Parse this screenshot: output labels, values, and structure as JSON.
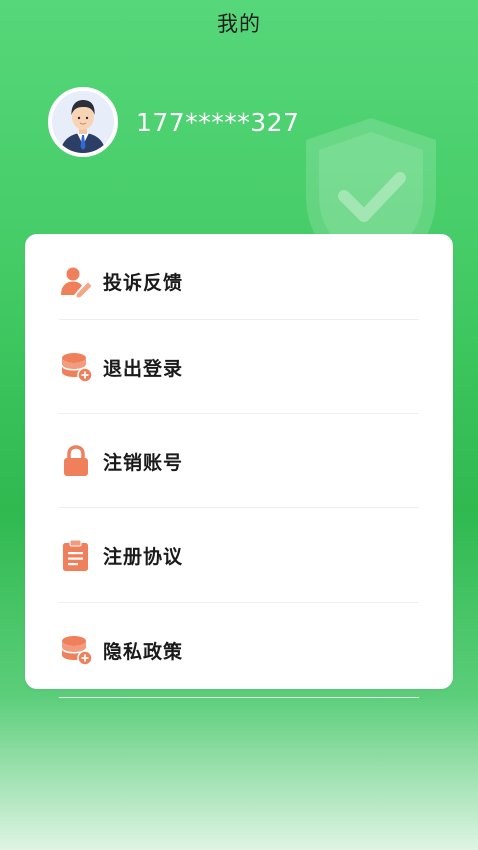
{
  "header": {
    "title": "我的"
  },
  "profile": {
    "phone": "177*****327",
    "avatar_icon": "businessman-avatar"
  },
  "theme": {
    "accent_green": "#45cc67",
    "icon_orange": "#f07f5b"
  },
  "menu": {
    "items": [
      {
        "label": "投诉反馈",
        "icon": "user-edit-icon"
      },
      {
        "label": "退出登录",
        "icon": "coin-stack-icon"
      },
      {
        "label": "注销账号",
        "icon": "lock-icon"
      },
      {
        "label": "注册协议",
        "icon": "clipboard-icon"
      },
      {
        "label": "隐私政策",
        "icon": "coin-stack-icon"
      }
    ]
  }
}
